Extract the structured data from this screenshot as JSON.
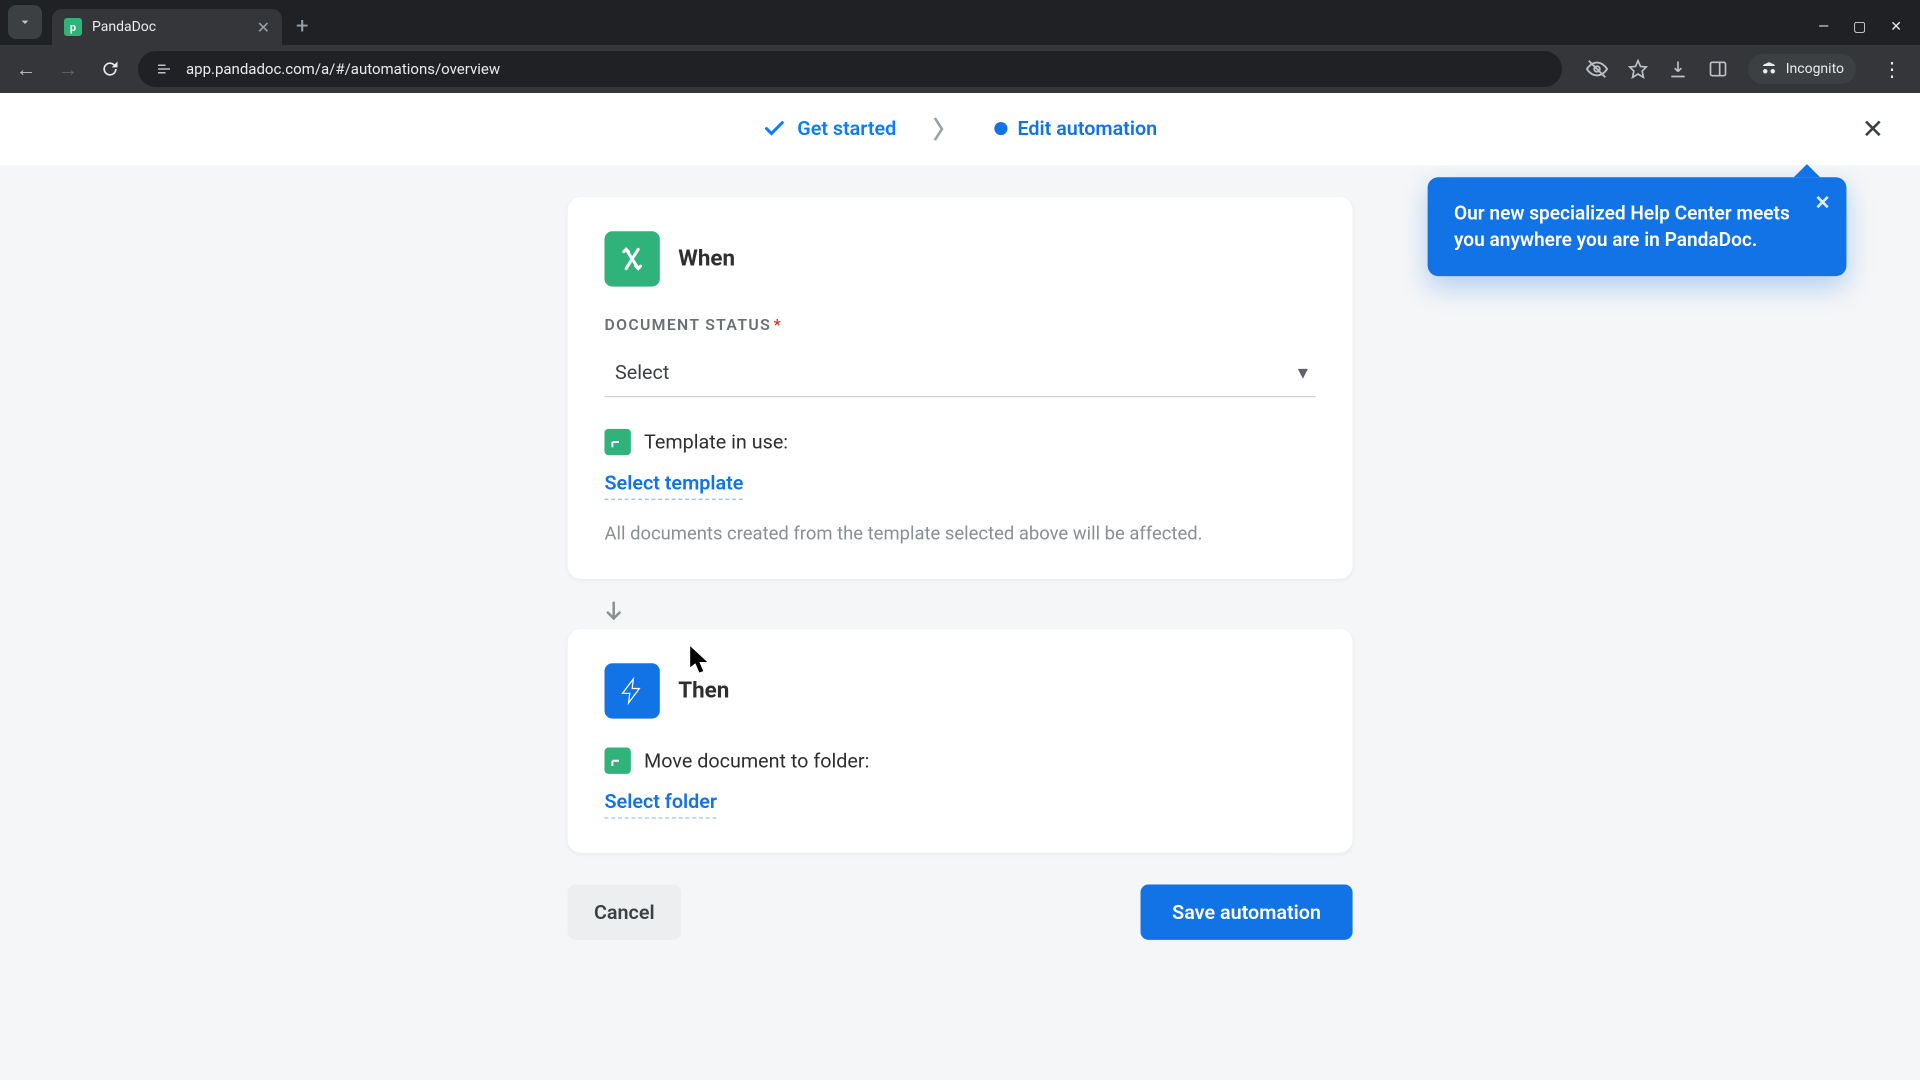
{
  "browser": {
    "tab_title": "PandaDoc",
    "url": "app.pandadoc.com/a/#/automations/overview",
    "incognito_label": "Incognito"
  },
  "stepper": {
    "step1": "Get started",
    "step2": "Edit automation"
  },
  "help_popup": {
    "text": "Our new specialized Help Center meets you anywhere you are in PandaDoc."
  },
  "when_card": {
    "title": "When",
    "field_label": "DOCUMENT STATUS",
    "select_placeholder": "Select",
    "template_label": "Template in use:",
    "select_template": "Select template",
    "hint": "All documents created from the template selected above will be affected."
  },
  "then_card": {
    "title": "Then",
    "move_label": "Move document to folder:",
    "select_folder": "Select folder"
  },
  "actions": {
    "cancel": "Cancel",
    "save": "Save automation"
  }
}
